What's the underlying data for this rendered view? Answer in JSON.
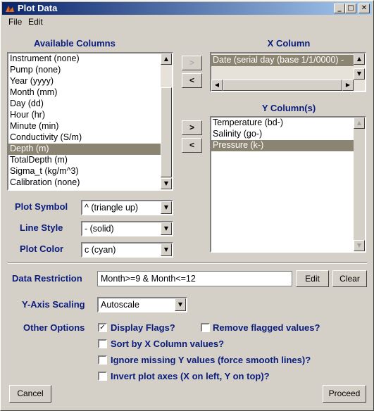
{
  "window": {
    "title": "Plot Data",
    "minimize_glyph": "_",
    "maximize_glyph": "□",
    "close_glyph": "✕"
  },
  "menu": {
    "file": "File",
    "edit": "Edit"
  },
  "available_columns": {
    "label": "Available Columns",
    "items": [
      "Instrument (none)",
      "Pump (none)",
      "Year (yyyy)",
      "Month (mm)",
      "Day (dd)",
      "Hour (hr)",
      "Minute (min)",
      "Conductivity (S/m)",
      "Depth (m)",
      "TotalDepth (m)",
      "Sigma_t (kg/m^3)",
      "Calibration (none)"
    ],
    "selected": "Depth (m)"
  },
  "x_column": {
    "label": "X Column",
    "value": "Date  (serial day (base 1/1/0000) - "
  },
  "y_columns": {
    "label": "Y Column(s)",
    "items": [
      "Temperature (bd-)",
      "Salinity (go-)",
      "Pressure (k-)"
    ],
    "selected": "Pressure (k-)"
  },
  "transfer": {
    "add_x": ">",
    "remove_x": "<",
    "add_y": ">",
    "remove_y": "<"
  },
  "plot_symbol": {
    "label": "Plot Symbol",
    "value": "^ (triangle up)"
  },
  "line_style": {
    "label": "Line Style",
    "value": "- (solid)"
  },
  "plot_color": {
    "label": "Plot Color",
    "value": "c (cyan)"
  },
  "data_restriction": {
    "label": "Data Restriction",
    "value": "Month>=9 & Month<=12",
    "edit": "Edit",
    "clear": "Clear"
  },
  "y_axis_scaling": {
    "label": "Y-Axis Scaling",
    "value": "Autoscale"
  },
  "other_options": {
    "label": "Other Options",
    "display_flags": {
      "label": "Display Flags?",
      "checked": true
    },
    "remove_flagged": {
      "label": "Remove flagged values?",
      "checked": false
    },
    "sort_by_x": {
      "label": "Sort by X Column values?",
      "checked": false
    },
    "ignore_missing": {
      "label": "Ignore missing Y values (force smooth lines)?",
      "checked": false
    },
    "invert_axes": {
      "label": "Invert plot axes (X on left, Y on top)?",
      "checked": false
    }
  },
  "buttons": {
    "cancel": "Cancel",
    "proceed": "Proceed"
  },
  "icons": {
    "scroll_up": "▲",
    "scroll_down": "▼",
    "scroll_left": "◀",
    "scroll_right": "▶",
    "dropdown": "▼",
    "check": "✓"
  }
}
